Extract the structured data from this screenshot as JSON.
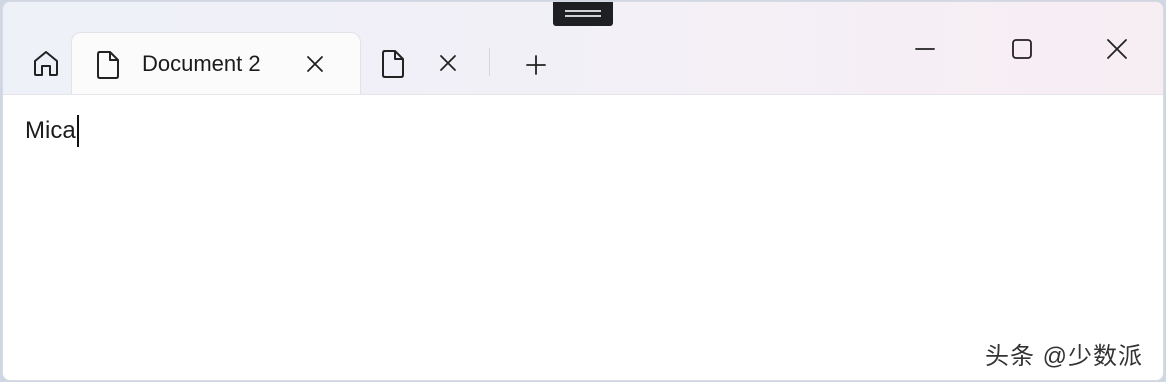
{
  "tabs": [
    {
      "title": "Document 2",
      "active": true,
      "icon": "document-icon"
    },
    {
      "title": "",
      "active": false,
      "icon": "document-icon"
    }
  ],
  "toolbar": {
    "home_icon": "home-icon",
    "new_tab_icon": "plus-icon"
  },
  "window_controls": {
    "minimize_icon": "minimize-icon",
    "maximize_icon": "maximize-icon",
    "close_icon": "close-icon"
  },
  "document": {
    "text": "Mica"
  },
  "watermark": {
    "text": "头条 @少数派"
  },
  "colors": {
    "titlebar_left": "#eef1f8",
    "titlebar_right": "#f7eef3",
    "content_bg": "#ffffff",
    "drag_handle": "#1e1f22"
  }
}
